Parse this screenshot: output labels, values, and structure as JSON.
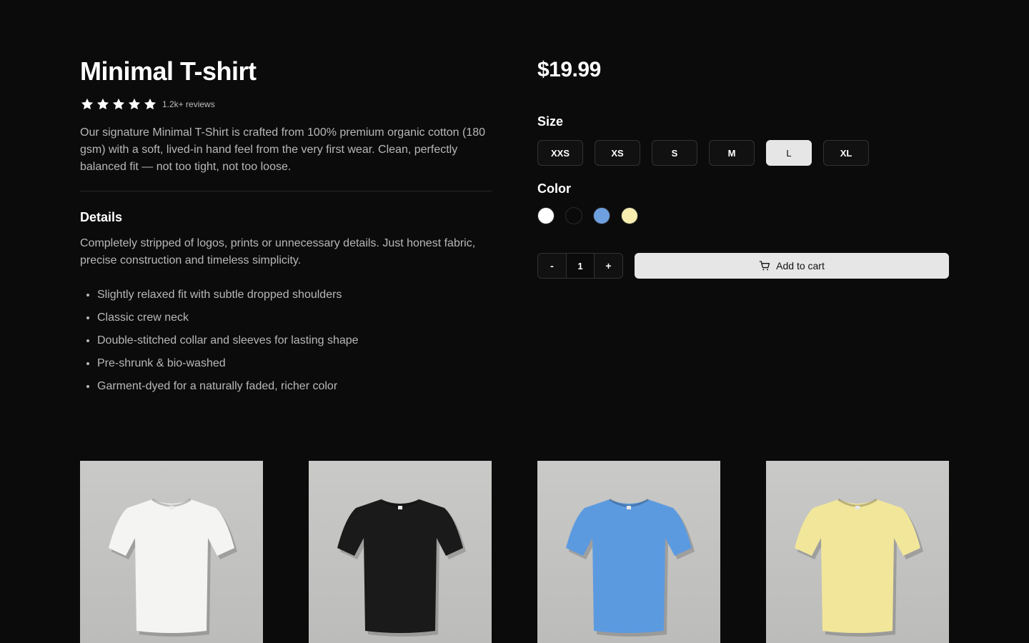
{
  "product": {
    "title": "Minimal T-shirt",
    "rating": 5,
    "reviews": "1.2k+ reviews",
    "description": "Our signature Minimal T-Shirt is crafted from 100% premium organic cotton (180 gsm) with a soft, lived-in hand feel from the very first wear. Clean, perfectly balanced fit — not too tight, not too loose.",
    "price": "$19.99"
  },
  "details": {
    "title": "Details",
    "text": "Completely stripped of logos, prints or unnecessary details. Just honest fabric, precise construction and timeless simplicity.",
    "features": [
      "Slightly relaxed fit with subtle dropped shoulders",
      "Classic crew neck",
      "Double-stitched collar and sleeves for lasting shape",
      "Pre-shrunk & bio-washed",
      "Garment-dyed for a naturally faded, richer color"
    ]
  },
  "size": {
    "label": "Size",
    "options": [
      "XXS",
      "XS",
      "S",
      "M",
      "L",
      "XL"
    ],
    "selected": "L"
  },
  "color": {
    "label": "Color",
    "options": [
      "#ffffff",
      "#0a0a0a",
      "#6ea0e0",
      "#f7eeb0"
    ]
  },
  "quantity": {
    "decrement": "-",
    "value": "1",
    "increment": "+"
  },
  "add_to_cart": {
    "label": "Add to cart",
    "icon": "cart-icon"
  },
  "gallery": [
    {
      "shirt_color": "#f4f4f2"
    },
    {
      "shirt_color": "#1a1a1a"
    },
    {
      "shirt_color": "#5c9ae0"
    },
    {
      "shirt_color": "#f2e69a"
    }
  ],
  "colors": {
    "background": "#0b0b0b",
    "muted_text": "#b8b8b8",
    "selected_button": "#e6e6e6"
  }
}
